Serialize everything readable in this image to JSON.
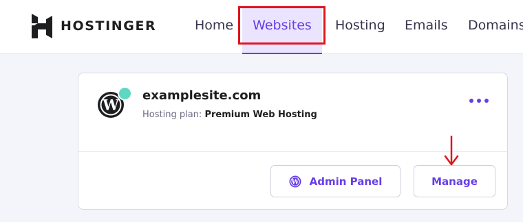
{
  "header": {
    "brand_name": "HOSTINGER",
    "nav": {
      "home": "Home",
      "websites": "Websites",
      "hosting": "Hosting",
      "emails": "Emails",
      "domains": "Domains"
    },
    "active_nav": "websites"
  },
  "website_card": {
    "domain": "examplesite.com",
    "plan_label": "Hosting plan:",
    "plan_value": "Premium Web Hosting",
    "status_color": "#5fd8c3",
    "cms_icon": "wordpress-icon",
    "more_icon": "more-horizontal-icon",
    "actions": {
      "admin_panel": "Admin Panel",
      "manage": "Manage"
    }
  },
  "annotations": {
    "highlight_target": "Websites",
    "arrow_target": "Manage",
    "color": "#e0141b"
  },
  "colors": {
    "accent": "#673de6",
    "accent_light": "#ebe4ff",
    "background": "#f4f4fb",
    "text": "#1d1e20"
  }
}
